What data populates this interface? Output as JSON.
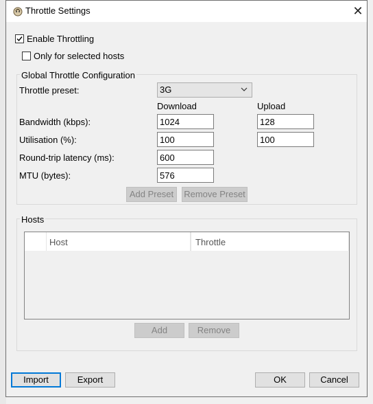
{
  "window": {
    "title": "Throttle Settings",
    "close_glyph": "✕"
  },
  "enable_throttling": {
    "label": "Enable Throttling",
    "checked": true
  },
  "only_selected_hosts": {
    "label": "Only for selected hosts",
    "checked": false
  },
  "global_config": {
    "title": "Global Throttle Configuration",
    "preset_label": "Throttle preset:",
    "preset_value": "3G",
    "download_header": "Download",
    "upload_header": "Upload",
    "bandwidth_label": "Bandwidth (kbps):",
    "bandwidth_download": "1024",
    "bandwidth_upload": "128",
    "utilisation_label": "Utilisation (%):",
    "utilisation_download": "100",
    "utilisation_upload": "100",
    "latency_label": "Round-trip latency (ms):",
    "latency_value": "600",
    "mtu_label": "MTU (bytes):",
    "mtu_value": "576",
    "add_preset": "Add Preset",
    "remove_preset": "Remove Preset"
  },
  "hosts": {
    "title": "Hosts",
    "columns": [
      "Host",
      "Throttle"
    ],
    "rows": [],
    "add": "Add",
    "remove": "Remove"
  },
  "footer": {
    "import": "Import",
    "export": "Export",
    "ok": "OK",
    "cancel": "Cancel"
  }
}
